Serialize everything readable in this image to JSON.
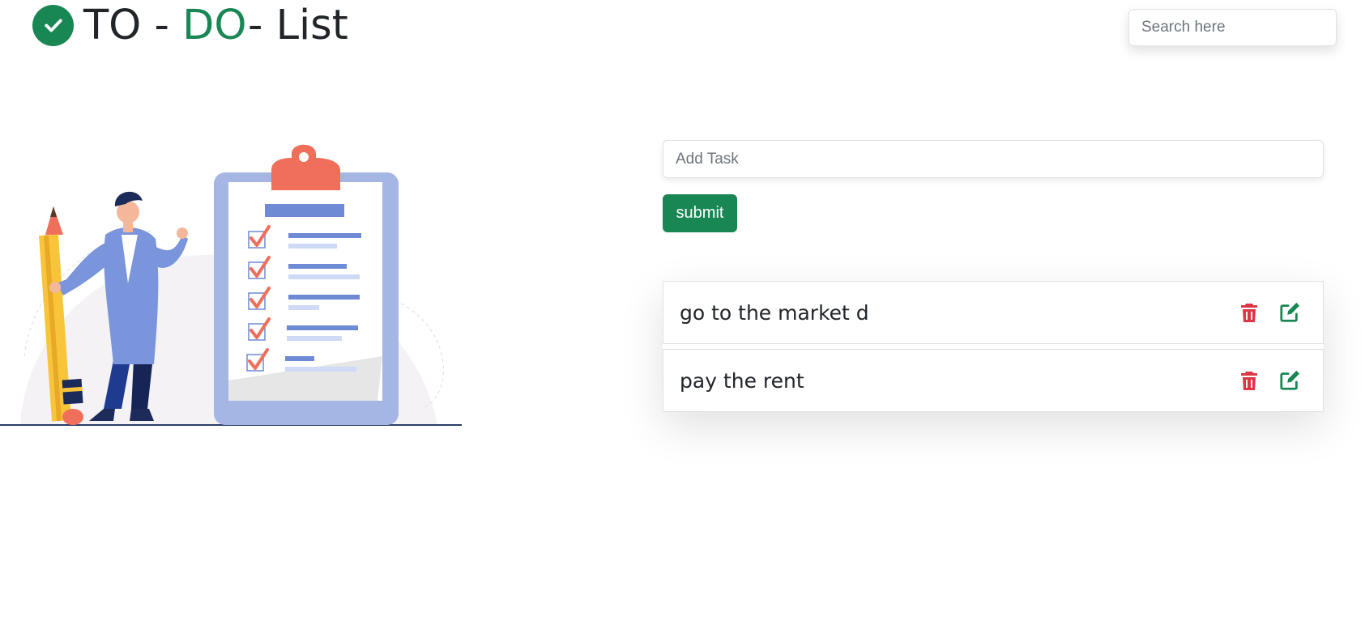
{
  "header": {
    "title_part1": "TO - ",
    "title_accent": "DO",
    "title_part2": "- List",
    "logo_icon": "check-circle-icon",
    "accent_color": "#198754"
  },
  "search": {
    "placeholder": "Search here",
    "value": ""
  },
  "task_form": {
    "placeholder": "Add Task",
    "value": "",
    "submit_label": "submit"
  },
  "tasks": [
    {
      "text": "go to the market d",
      "delete_icon": "trash-icon",
      "edit_icon": "edit-icon"
    },
    {
      "text": "pay the rent",
      "delete_icon": "trash-icon",
      "edit_icon": "edit-icon"
    }
  ],
  "colors": {
    "primary": "#198754",
    "danger": "#dc3545"
  }
}
